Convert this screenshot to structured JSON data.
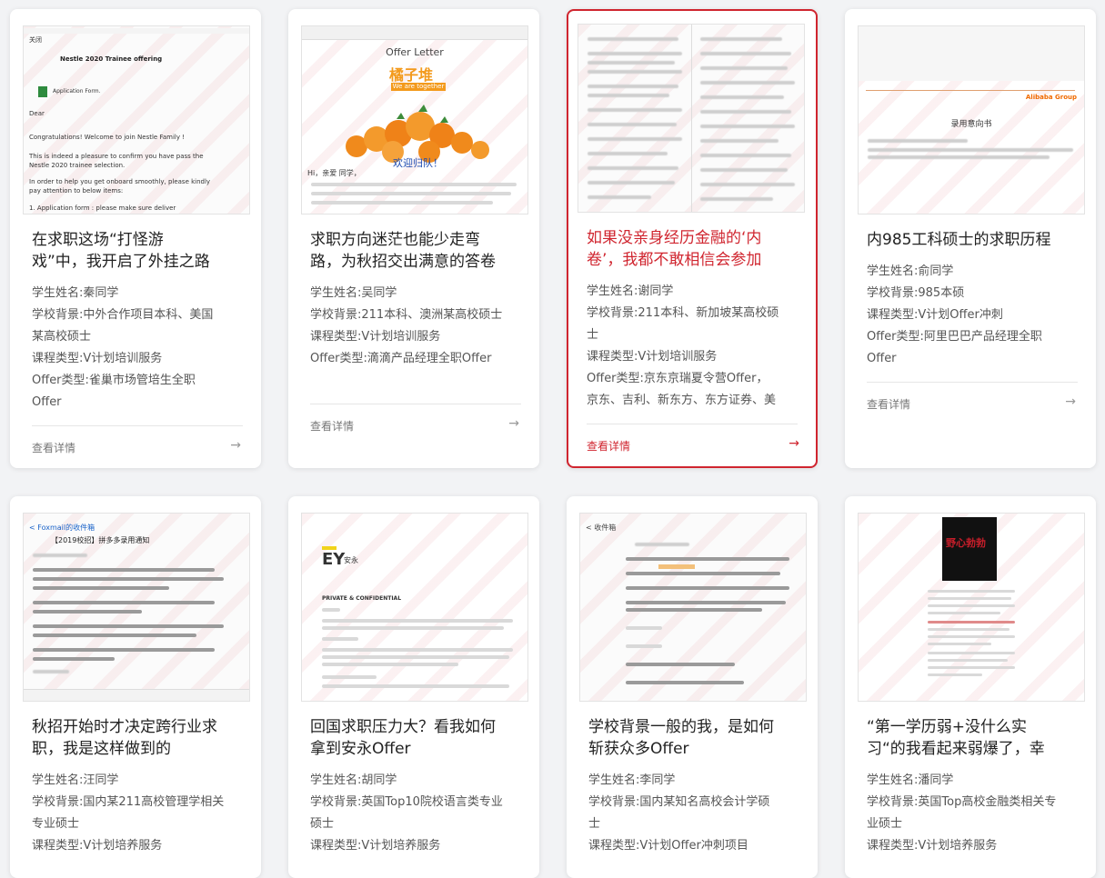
{
  "labels": {
    "name": "学生姓名:",
    "school": "学校背景:",
    "course": "课程类型:",
    "offer": "Offer类型:",
    "more": "查看详情",
    "arrow": "→"
  },
  "thumb_text": {
    "nestle_title": "Nestle 2020 Trainee offering",
    "nestle_close": "关闭",
    "nestle_attach": "Application Form.",
    "nestle_dear": "Dear",
    "nestle_congrats": "Congratulations! Welcome to join Nestle Family !",
    "nestle_pleasure": "This is indeed a pleasure to confirm you have pass the Nestle 2020 trainee selection.",
    "nestle_inorder": "In order to help you get onboard smoothly, please kindly pay attention to below items:",
    "nestle_item1": "1. Application form : please make sure deliver",
    "offer_letter": "Offer Letter",
    "orange_brand": "橘子堆",
    "orange_slogan": "We are together",
    "welcome": "欢迎归队！",
    "greeting": "Hi，亲爱          同学，",
    "ali_title": "录用意向书",
    "ali_logo": "Alibaba Group",
    "ey_logo": "EY",
    "ey_cn": "安永",
    "ey_private": "PRIVATE & CONFIDENTIAL",
    "foxmail": "< Foxmail的收件箱",
    "foxmail_subject": "【2019校招】拼多多录用通知",
    "inbox": "< 收件箱",
    "poster": "野心勃勃"
  },
  "cards": [
    {
      "title": "在求职这场“打怪游戏”中，我开启了外挂之路",
      "title_l1": "在求职这场“打怪游",
      "title_l2": "戏”中，我开启了外挂之路",
      "name": "秦同学",
      "school_l1": "中外合作项目本科、美国",
      "school_l2": "某高校硕士",
      "course": "V计划培训服务",
      "offer_l1": "雀巢市场管培生全职",
      "offer_l2": "Offer"
    },
    {
      "title_l1": "求职方向迷茫也能少走弯",
      "title_l2": "路，为秋招交出满意的答卷",
      "name": "吴同学",
      "school_l1": "211本科、澳洲某高校硕士",
      "course": "V计划培训服务",
      "offer_l1": "滴滴产品经理全职Offer"
    },
    {
      "title_l1": "如果没亲身经历金融的‘内",
      "title_l2": "卷’，我都不敢相信会参加",
      "name": "谢同学",
      "school_l1": "211本科、新加坡某高校硕",
      "school_l2": "士",
      "course": "V计划培训服务",
      "offer_l1": "京东京瑞夏令营Offer，",
      "offer_l2": "京东、吉利、新东方、东方证券、美"
    },
    {
      "title_l1": "内985工科硕士的求职历程",
      "name": "俞同学",
      "school_l1": "985本硕",
      "course": "V计划Offer冲刺",
      "offer_l1": "阿里巴巴产品经理全职",
      "offer_l2": "Offer"
    },
    {
      "title_l1": "秋招开始时才决定跨行业求",
      "title_l2": "职，我是这样做到的",
      "name": "汪同学",
      "school_l1": "国内某211高校管理学相关",
      "school_l2": "专业硕士",
      "course": "V计划培养服务"
    },
    {
      "title_l1": "回国求职压力大？看我如何",
      "title_l2": "拿到安永Offer",
      "name": "胡同学",
      "school_l1": "英国Top10院校语言类专业",
      "school_l2": "硕士",
      "course": "V计划培养服务"
    },
    {
      "title_l1": "学校背景一般的我，是如何",
      "title_l2": "斩获众多Offer",
      "name": "李同学",
      "school_l1": "国内某知名高校会计学硕",
      "school_l2": "士",
      "course": "V计划Offer冲刺项目"
    },
    {
      "title_l1": "“第一学历弱+没什么实",
      "title_l2": "习“的我看起来弱爆了，幸",
      "name": "潘同学",
      "school_l1": "英国Top高校金融类相关专",
      "school_l2": "业硕士",
      "course": "V计划培养服务"
    }
  ]
}
